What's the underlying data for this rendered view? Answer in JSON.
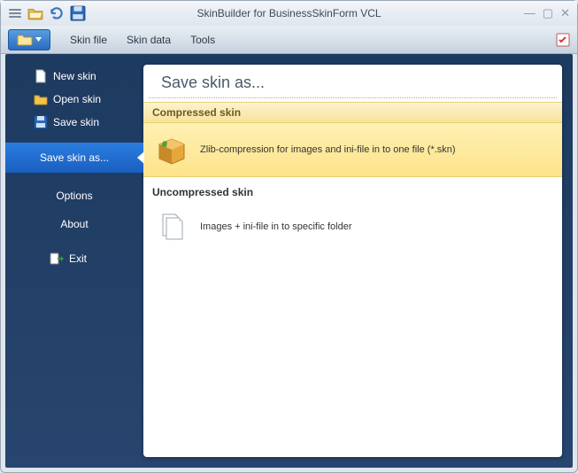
{
  "window": {
    "title": "SkinBuilder for BusinessSkinForm VCL"
  },
  "toolbar": {
    "menu1": "Skin file",
    "menu2": "Skin data",
    "menu3": "Tools"
  },
  "sidebar": {
    "newSkin": "New skin",
    "openSkin": "Open skin",
    "saveSkin": "Save skin",
    "saveSkinAs": "Save skin as...",
    "options": "Options",
    "about": "About",
    "exit": "Exit"
  },
  "panel": {
    "title": "Save skin as...",
    "compressed": {
      "header": "Compressed skin",
      "desc": "Zlib-compression for images and ini-file in to one file (*.skn)"
    },
    "uncompressed": {
      "header": "Uncompressed skin",
      "desc": "Images + ini-file in to specific folder"
    }
  }
}
